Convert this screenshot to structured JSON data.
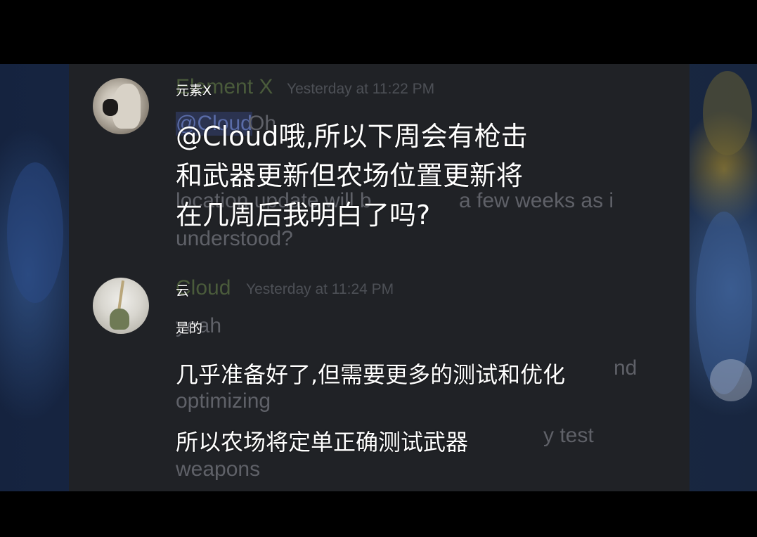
{
  "messages": [
    {
      "author_original": "Element X",
      "author_overlay": "元素X",
      "timestamp": "Yesterday at 11:22 PM",
      "mention_original": "@Cloud",
      "text_original_fragments": [
        "Oh",
        "location update will b",
        "a few weeks as i",
        "understood?"
      ],
      "text_overlay_lines": [
        "@Cloud哦,所以下周会有枪击",
        "和武器更新但农场位置更新将",
        "在几周后我明白了吗?"
      ]
    },
    {
      "author_original": "Cloud",
      "author_overlay": "云",
      "timestamp": "Yesterday at 11:24 PM",
      "lines": [
        {
          "original": "yeah",
          "overlay": "是的"
        },
        {
          "original_end": "nd",
          "original_next": "optimizing",
          "overlay": "几乎准备好了,但需要更多的测试和优化"
        },
        {
          "original_end": "y test",
          "original_next": "weapons",
          "overlay": "所以农场将定单正确测试武器"
        }
      ]
    }
  ],
  "colors": {
    "chat_bg": "#202226",
    "outer_bg": "#1b2a48",
    "overlay_text": "#ffffff",
    "ghost_text": "#5f6168"
  }
}
